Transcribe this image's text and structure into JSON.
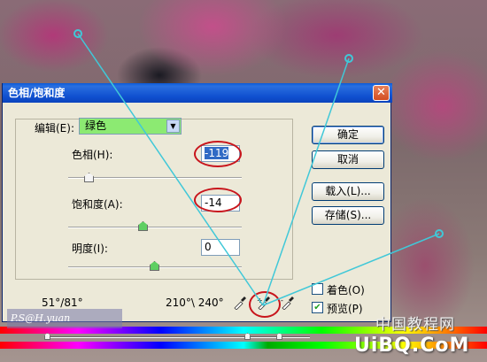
{
  "window": {
    "title": "色相/饱和度"
  },
  "edit": {
    "label": "编辑(E):",
    "value": "绿色"
  },
  "hue": {
    "label": "色相(H):",
    "value": "-119"
  },
  "saturation": {
    "label": "饱和度(A):",
    "value": "-14"
  },
  "lightness": {
    "label": "明度(I):",
    "value": "0"
  },
  "buttons": {
    "ok": "确定",
    "cancel": "取消",
    "load": "载入(L)...",
    "save": "存储(S)..."
  },
  "range": {
    "left": "51°/81°",
    "right": "210°\\ 240°"
  },
  "options": {
    "colorize": {
      "label": "着色(O)",
      "checked": false
    },
    "preview": {
      "label": "预览(P)",
      "checked": true
    }
  },
  "watermark": {
    "author": "P.S@H.yuan",
    "site_cn": "中国教程网",
    "site_en": "UiBQ.CoM"
  },
  "colors": {
    "highlight_ring": "#c8151c",
    "pointer_line": "#40c8d8",
    "dropdown_bg": "#8cea72"
  }
}
